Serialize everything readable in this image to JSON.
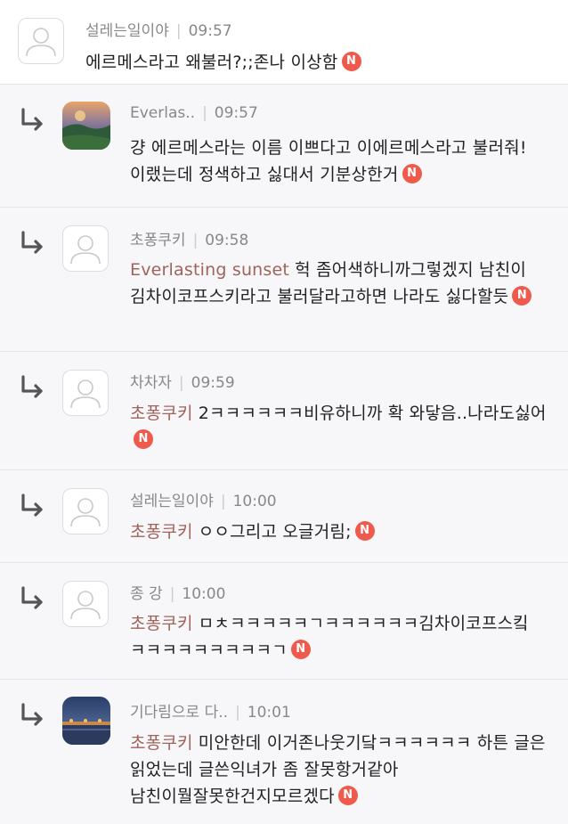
{
  "comments": [
    {
      "author": "설레는일이야",
      "time": "09:57",
      "mention": "",
      "text": "에르메스라고 왜불러?;;존나 이상함",
      "avatar": "default-avatar-icon",
      "reply": false
    },
    {
      "author": "Everlas..",
      "time": "09:57",
      "mention": "",
      "text": "걍 에르메스라는 이름 이쁘다고 이에르메스라고 불러줘! 이랬는데 정색하고 싫대서 기분상한거",
      "avatar": "sunset-landscape-avatar",
      "reply": true
    },
    {
      "author": "초퐁쿠키",
      "time": "09:58",
      "mention": "Everlasting sunset",
      "text": "헉 좀어색하니까그렇겠지 남친이 김차이코프스키라고 불러달라고하면 나라도 싫다할듯",
      "avatar": "default-avatar-icon",
      "reply": true
    },
    {
      "author": "차차자",
      "time": "09:59",
      "mention": "초퐁쿠키",
      "text": "2ㅋㅋㅋㅋㅋㅋ비유하니까 확 와닿음..나라도싫어",
      "avatar": "default-avatar-icon",
      "reply": true
    },
    {
      "author": "설레는일이야",
      "time": "10:00",
      "mention": "초퐁쿠키",
      "text": "ㅇㅇ그리고 오글거림;",
      "avatar": "default-avatar-icon",
      "reply": true
    },
    {
      "author": "종 강",
      "time": "10:00",
      "mention": "초퐁쿠키",
      "text": "ㅁㅊㅋㅋㅋㅋㅋㄱㅋㅋㅋㅋㅋㅋ김차이코프스킼ㅋㅋㅋㅋㅋㅋㅋㅋㅋㄱ",
      "avatar": "default-avatar-icon",
      "reply": true
    },
    {
      "author": "기다림으로 다..",
      "time": "10:01",
      "mention": "초퐁쿠키",
      "text": "미안한데 이거존나웃기닼ㅋㅋㅋㅋㅋㅋ 하튼 글은 읽었는데 글쓴익녀가 좀 잘못항거같아 남친이뭘잘못한건지모르겠다",
      "avatar": "night-bridge-avatar",
      "reply": true
    }
  ],
  "badge_label": "N",
  "colors": {
    "mention": "#a0635a",
    "badge": "#ee5a4c",
    "reply_bg": "#f7f7fa",
    "meta": "#888888"
  }
}
